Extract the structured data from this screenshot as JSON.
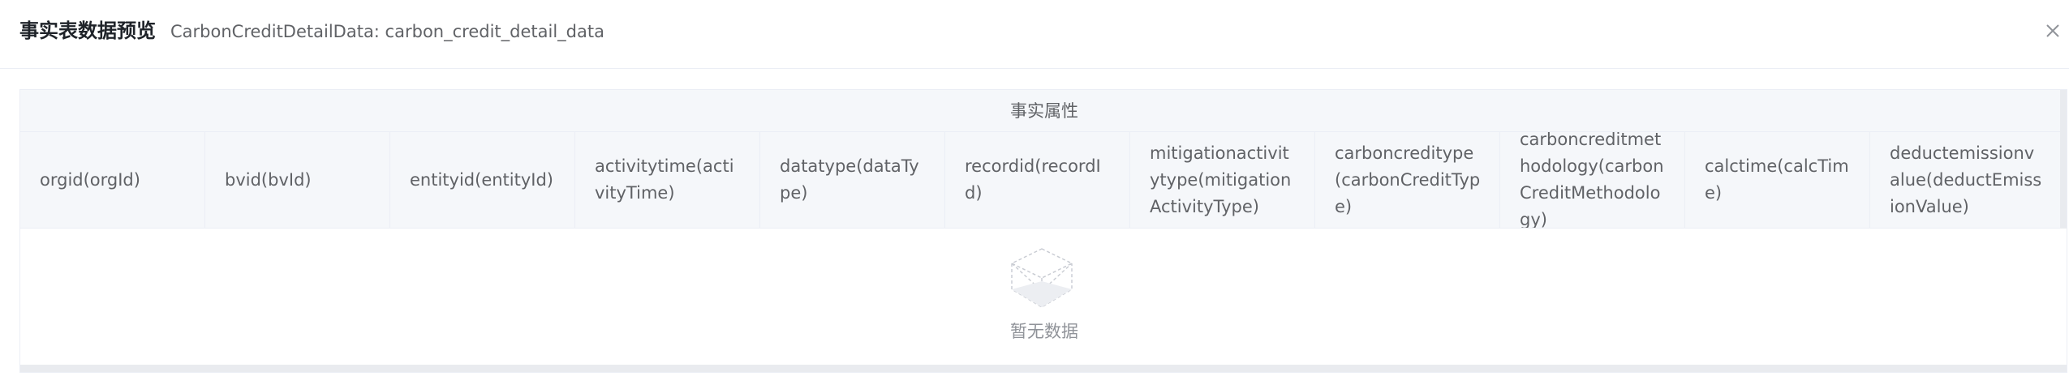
{
  "dialog": {
    "title": "事实表数据预览",
    "subtitle": "CarbonCreditDetailData: carbon_credit_detail_data",
    "close_icon": "close-icon"
  },
  "table": {
    "group_header": "事实属性",
    "columns": [
      "orgid(orgId)",
      "bvid(bvId)",
      "entityid(entityId)",
      "activitytime(activityTime)",
      "datatype(dataType)",
      "recordid(recordId)",
      "mitigationactivitytype(mitigationActivityType)",
      "carboncreditype(carbonCreditType)",
      "carboncreditmethodology(carbonCreditMethodology)",
      "calctime(calcTime)",
      "deductemissionvalue(deductEmissionValue)"
    ],
    "rows": [],
    "empty_text": "暂无数据",
    "empty_icon": "empty-box-icon"
  },
  "colors": {
    "header_bg": "#f5f7fa",
    "border": "#ebeef5",
    "text": "#606266",
    "muted_text": "#909399"
  }
}
